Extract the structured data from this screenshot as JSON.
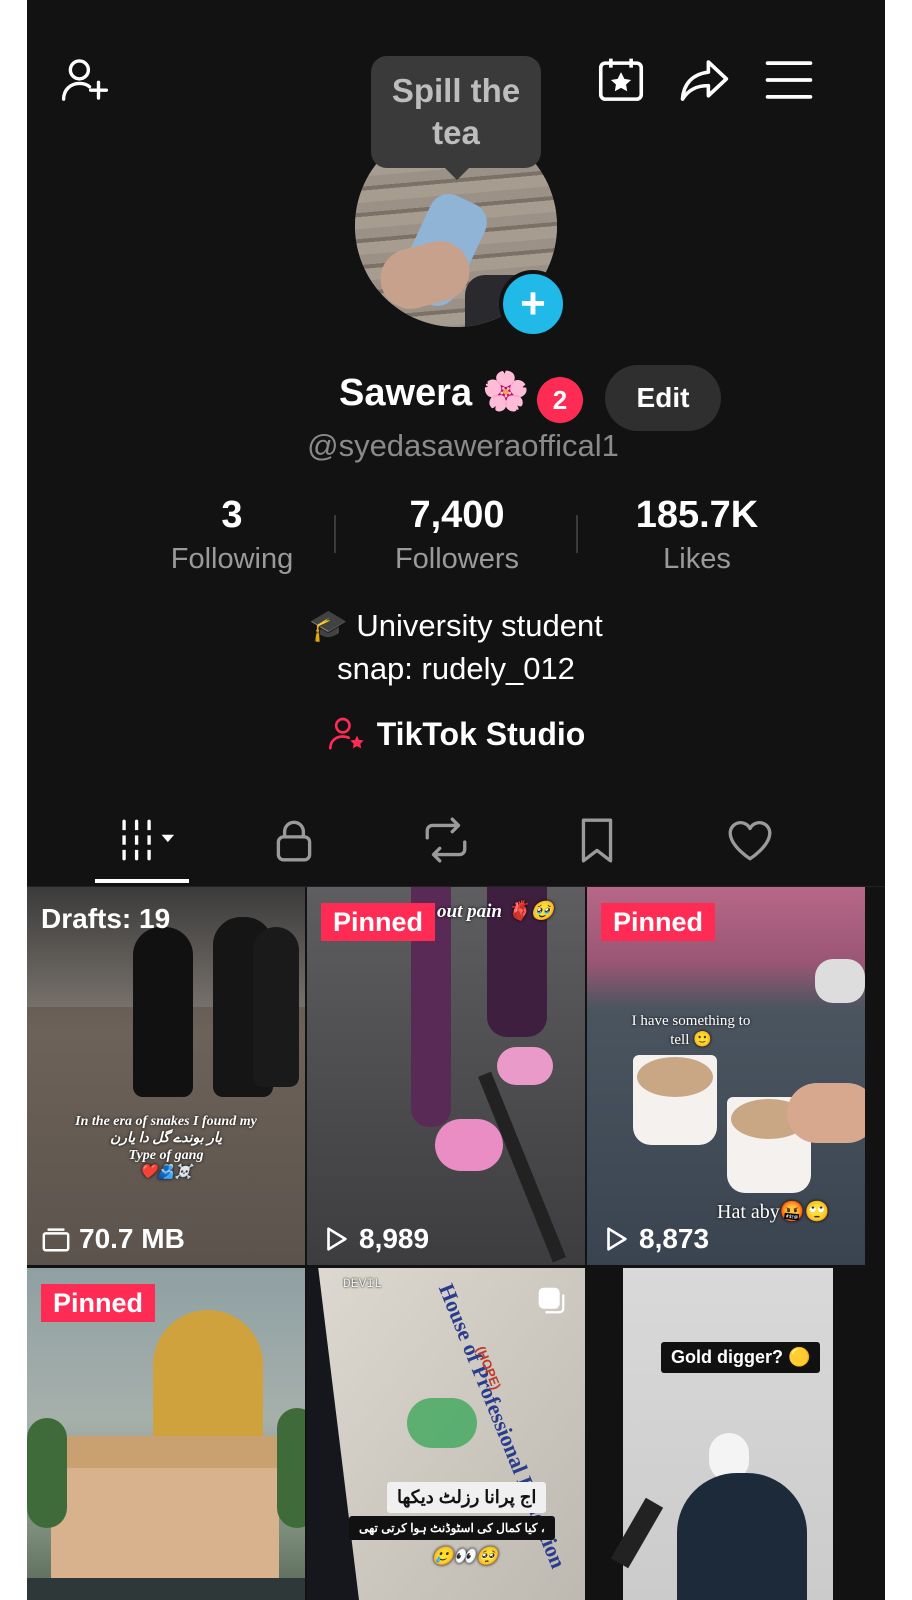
{
  "tooltip": "Spill the tea",
  "profile": {
    "display_name": "Sawera",
    "name_emoji": "🌸",
    "notification_count": "2",
    "edit_label": "Edit",
    "handle": "@syedasaweraoffical1"
  },
  "stats": [
    {
      "value": "3",
      "label": "Following"
    },
    {
      "value": "7,400",
      "label": "Followers"
    },
    {
      "value": "185.7K",
      "label": "Likes"
    }
  ],
  "bio": {
    "line1": "🎓 University student",
    "line2": "snap: rudely_012"
  },
  "studio_label": "TikTok Studio",
  "tabs": [
    "videos-grid",
    "private",
    "reposts",
    "favorites",
    "liked"
  ],
  "grid": [
    {
      "badge": "Drafts: 19",
      "footer": "70.7 MB",
      "caption": "In the era of snakes I found my",
      "caption2": "یار بوندے گل دا یارن",
      "caption3": "Type of gang",
      "caption4": "❤️🫂☠️"
    },
    {
      "badge": "Pinned",
      "footer": "8,989",
      "caption": "out pain 🫀🥹"
    },
    {
      "badge": "Pinned",
      "footer": "8,873",
      "caption": "I have something to tell 🙂",
      "caption2": "Hat aby🤬🙄"
    },
    {
      "badge": "Pinned"
    },
    {
      "caption": "اج پرانا رزلٹ دیکھا",
      "caption2": "کیا کمال کی اسٹوڈنٹ ہوا کرتی تھی ،",
      "caption3": "🥲👀🥺",
      "label": "DEVIL",
      "doc_title": "House of Professional Education",
      "doc_abbr": "(HOPE)"
    },
    {
      "caption": "Gold digger? 🟡"
    }
  ],
  "colors": {
    "accent": "#fe2c55",
    "avatar_plus": "#20b9e8",
    "background": "#121212"
  }
}
